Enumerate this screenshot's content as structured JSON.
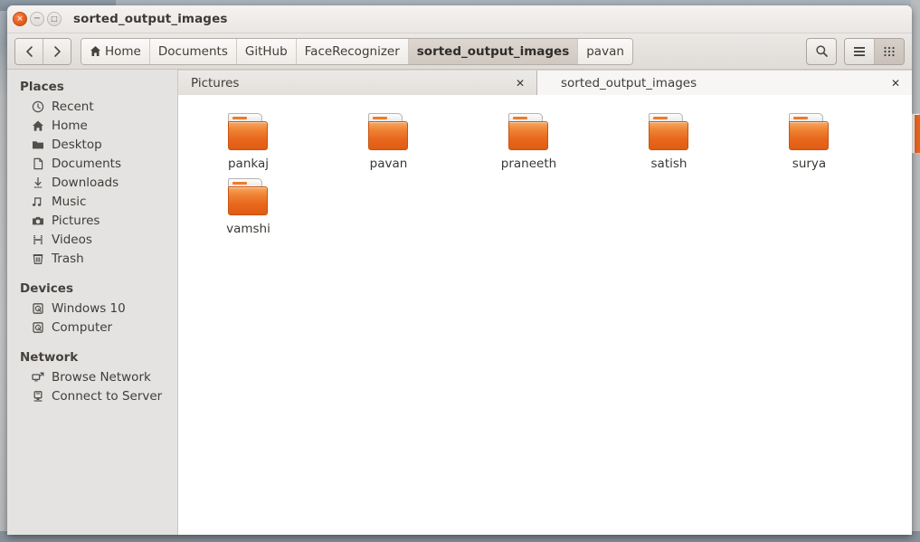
{
  "window": {
    "title": "sorted_output_images",
    "controls": {
      "close": "×",
      "minimize": "−",
      "maximize": "□"
    }
  },
  "toolbar": {
    "back_label": "Back",
    "forward_label": "Forward",
    "breadcrumbs": [
      {
        "label": "Home",
        "icon": "home-icon",
        "active": false
      },
      {
        "label": "Documents",
        "icon": "",
        "active": false
      },
      {
        "label": "GitHub",
        "icon": "",
        "active": false
      },
      {
        "label": "FaceRecognizer",
        "icon": "",
        "active": false
      },
      {
        "label": "sorted_output_images",
        "icon": "",
        "active": true
      },
      {
        "label": "pavan",
        "icon": "",
        "active": false
      }
    ],
    "search_label": "Search",
    "list_view_label": "List view",
    "icon_view_label": "Icon view"
  },
  "sidebar": {
    "sections": [
      {
        "header": "Places",
        "items": [
          {
            "label": "Recent",
            "icon": "clock-icon"
          },
          {
            "label": "Home",
            "icon": "home-icon"
          },
          {
            "label": "Desktop",
            "icon": "folder-icon"
          },
          {
            "label": "Documents",
            "icon": "document-icon"
          },
          {
            "label": "Downloads",
            "icon": "download-icon"
          },
          {
            "label": "Music",
            "icon": "music-icon"
          },
          {
            "label": "Pictures",
            "icon": "camera-icon"
          },
          {
            "label": "Videos",
            "icon": "film-icon"
          },
          {
            "label": "Trash",
            "icon": "trash-icon"
          }
        ]
      },
      {
        "header": "Devices",
        "items": [
          {
            "label": "Windows 10",
            "icon": "drive-icon"
          },
          {
            "label": "Computer",
            "icon": "drive-icon"
          }
        ]
      },
      {
        "header": "Network",
        "items": [
          {
            "label": "Browse Network",
            "icon": "network-icon"
          },
          {
            "label": "Connect to Server",
            "icon": "server-icon"
          }
        ]
      }
    ]
  },
  "tabs": [
    {
      "label": "Pictures",
      "active": false,
      "close": "✕"
    },
    {
      "label": "sorted_output_images",
      "active": true,
      "close": "✕"
    }
  ],
  "files": [
    {
      "name": "pankaj",
      "type": "folder"
    },
    {
      "name": "pavan",
      "type": "folder"
    },
    {
      "name": "praneeth",
      "type": "folder"
    },
    {
      "name": "satish",
      "type": "folder"
    },
    {
      "name": "surya",
      "type": "folder"
    },
    {
      "name": "vamshi",
      "type": "folder"
    }
  ],
  "colors": {
    "folder_orange": "#e8671d",
    "close_button": "#df5718",
    "sidebar_bg": "#e5e3e1",
    "content_bg": "#ffffff"
  }
}
